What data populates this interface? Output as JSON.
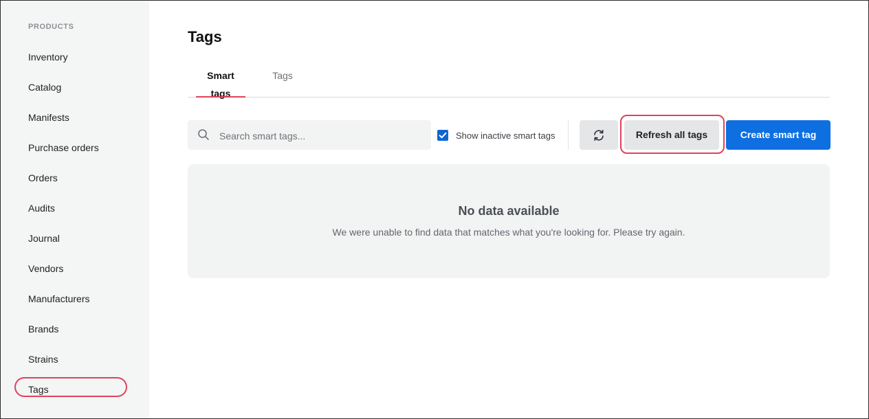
{
  "sidebar": {
    "section_label": "PRODUCTS",
    "items": [
      {
        "label": "Inventory"
      },
      {
        "label": "Catalog"
      },
      {
        "label": "Manifests"
      },
      {
        "label": "Purchase orders"
      },
      {
        "label": "Orders"
      },
      {
        "label": "Audits"
      },
      {
        "label": "Journal"
      },
      {
        "label": "Vendors"
      },
      {
        "label": "Manufacturers"
      },
      {
        "label": "Brands"
      },
      {
        "label": "Strains"
      },
      {
        "label": "Tags"
      }
    ],
    "selected": "Tags"
  },
  "main": {
    "title": "Tags",
    "tabs": [
      {
        "label": "Smart tags",
        "active": true
      },
      {
        "label": "Tags",
        "active": false
      }
    ],
    "toolbar": {
      "search_placeholder": "Search smart tags...",
      "search_value": "",
      "search_icon": "search-icon",
      "show_inactive_label": "Show inactive smart tags",
      "show_inactive_checked": true,
      "sync_icon": "sync-icon",
      "refresh_label": "Refresh all tags",
      "create_label": "Create smart tag"
    },
    "empty_state": {
      "title": "No data available",
      "message": "We were unable to find data that matches what you're looking for. Please try again."
    }
  },
  "colors": {
    "accent_red": "#e0415a",
    "primary_blue": "#0d6fe0",
    "sidebar_bg": "#f4f5f5"
  }
}
